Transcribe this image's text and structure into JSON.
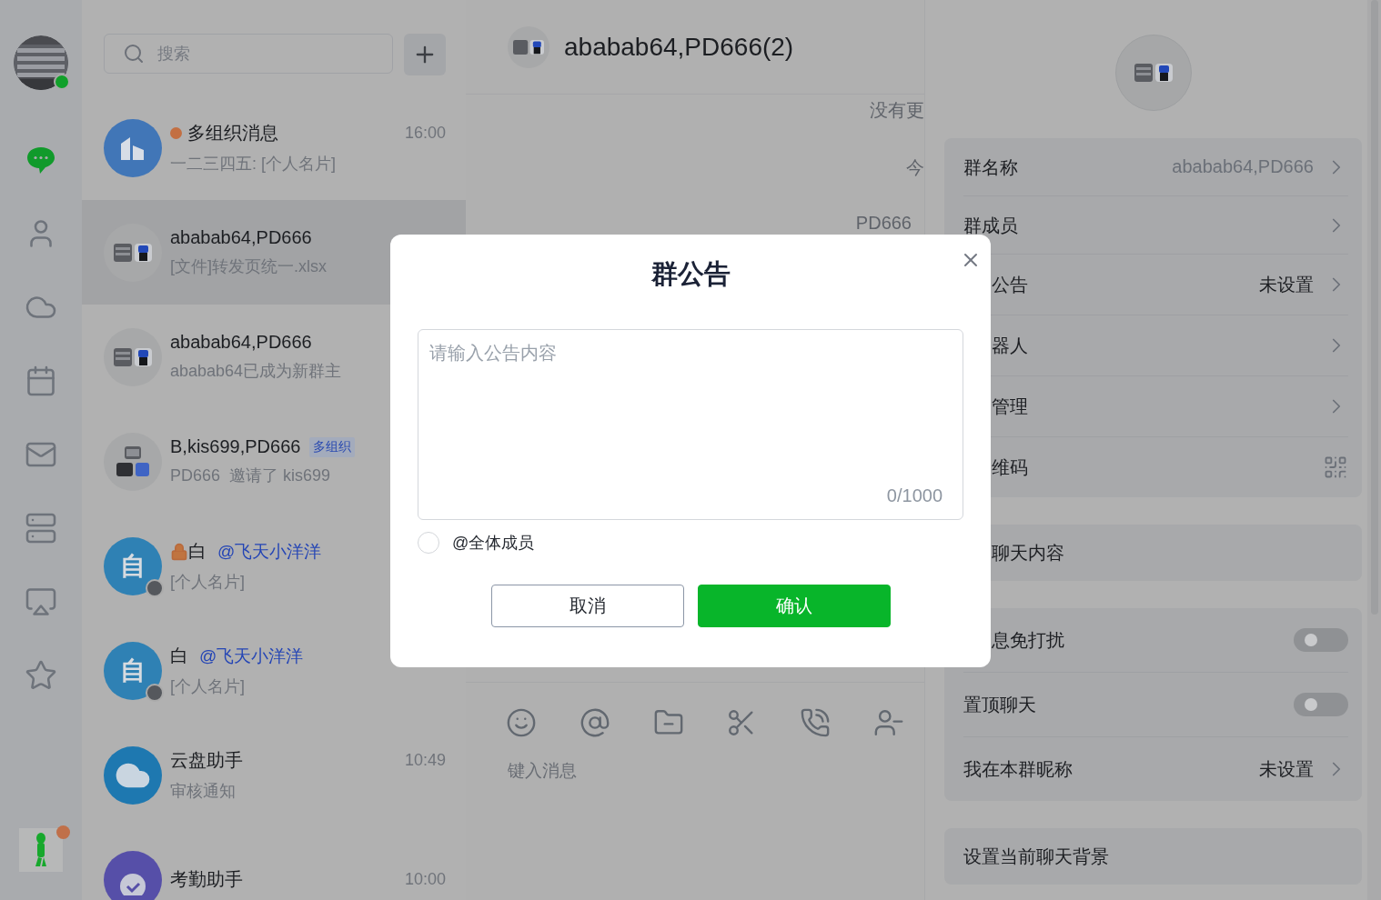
{
  "sidebar": {
    "profile": {
      "online": true
    },
    "items": [
      {
        "kind": "chat",
        "selected": true
      },
      {
        "kind": "contacts",
        "selected": false
      },
      {
        "kind": "cloud",
        "selected": false
      },
      {
        "kind": "calendar",
        "selected": false
      },
      {
        "kind": "mail",
        "selected": false
      },
      {
        "kind": "storage",
        "selected": false
      },
      {
        "kind": "screen",
        "selected": false
      },
      {
        "kind": "star",
        "selected": false
      }
    ],
    "app": {
      "badge": true
    }
  },
  "chat_list": {
    "search": {
      "placeholder": "搜索"
    },
    "items": [
      {
        "kind": "org",
        "name": "多组织消息",
        "unread": true,
        "time": "16:00",
        "preview": "一二三四五: [个人名片]",
        "selected": false
      },
      {
        "kind": "group",
        "name": "ababab64,PD666",
        "preview": "[文件]转发页统一.xlsx",
        "selected": true
      },
      {
        "kind": "group",
        "name": "ababab64,PD666",
        "preview": "ababab64已成为新群主",
        "selected": false
      },
      {
        "kind": "group3",
        "name": "B,kis699,PD666",
        "tag": "多组织",
        "preview": "PD666  邀请了 kis699",
        "selected": false
      },
      {
        "kind": "letter",
        "avatar_text": "自",
        "online": false,
        "locked": true,
        "name": "白",
        "mention": "@飞天小洋洋",
        "preview": "[个人名片]",
        "selected": false
      },
      {
        "kind": "letter",
        "avatar_text": "自",
        "online": false,
        "locked": false,
        "name": "白",
        "mention": "@飞天小洋洋",
        "preview": "[个人名片]",
        "selected": false
      },
      {
        "kind": "cloud",
        "name": "云盘助手",
        "time": "10:49",
        "preview": "审核通知",
        "selected": false
      },
      {
        "kind": "check",
        "name": "考勤助手",
        "time": "10:00",
        "selected": false
      }
    ]
  },
  "chat": {
    "title": "ababab64,PD666(2)",
    "messages": [
      "没有更",
      "今",
      "PD666"
    ],
    "input": {
      "placeholder": "键入消息"
    }
  },
  "settings": {
    "groups": [
      [
        {
          "kind": "link",
          "label": "群名称",
          "value": "ababab64,PD666",
          "muted": true
        },
        {
          "kind": "link",
          "label": "群成员"
        },
        {
          "kind": "link",
          "label": "公告",
          "value": "未设置",
          "covered": true
        },
        {
          "kind": "link",
          "label": "器人",
          "covered": true
        },
        {
          "kind": "link",
          "label": "管理",
          "covered": true
        },
        {
          "kind": "qr",
          "label": "维码",
          "covered": true
        }
      ],
      [
        {
          "kind": "plain",
          "label": "聊天内容",
          "covered": true
        }
      ],
      [
        {
          "kind": "toggle",
          "label": "息免打扰",
          "on": false,
          "covered": true
        },
        {
          "kind": "toggle",
          "label": "置顶聊天",
          "on": false
        },
        {
          "kind": "link",
          "label": "我在本群昵称",
          "value": "未设置"
        }
      ],
      [
        {
          "kind": "plain",
          "label": "设置当前聊天背景"
        }
      ]
    ]
  },
  "dialog": {
    "title": "群公告",
    "placeholder": "请输入公告内容",
    "counter": "0/1000",
    "mention_all": {
      "label": "@全体成员",
      "checked": false
    },
    "buttons": [
      {
        "label": "取消",
        "kind": "secondary"
      },
      {
        "label": "确认",
        "kind": "primary"
      }
    ]
  }
}
